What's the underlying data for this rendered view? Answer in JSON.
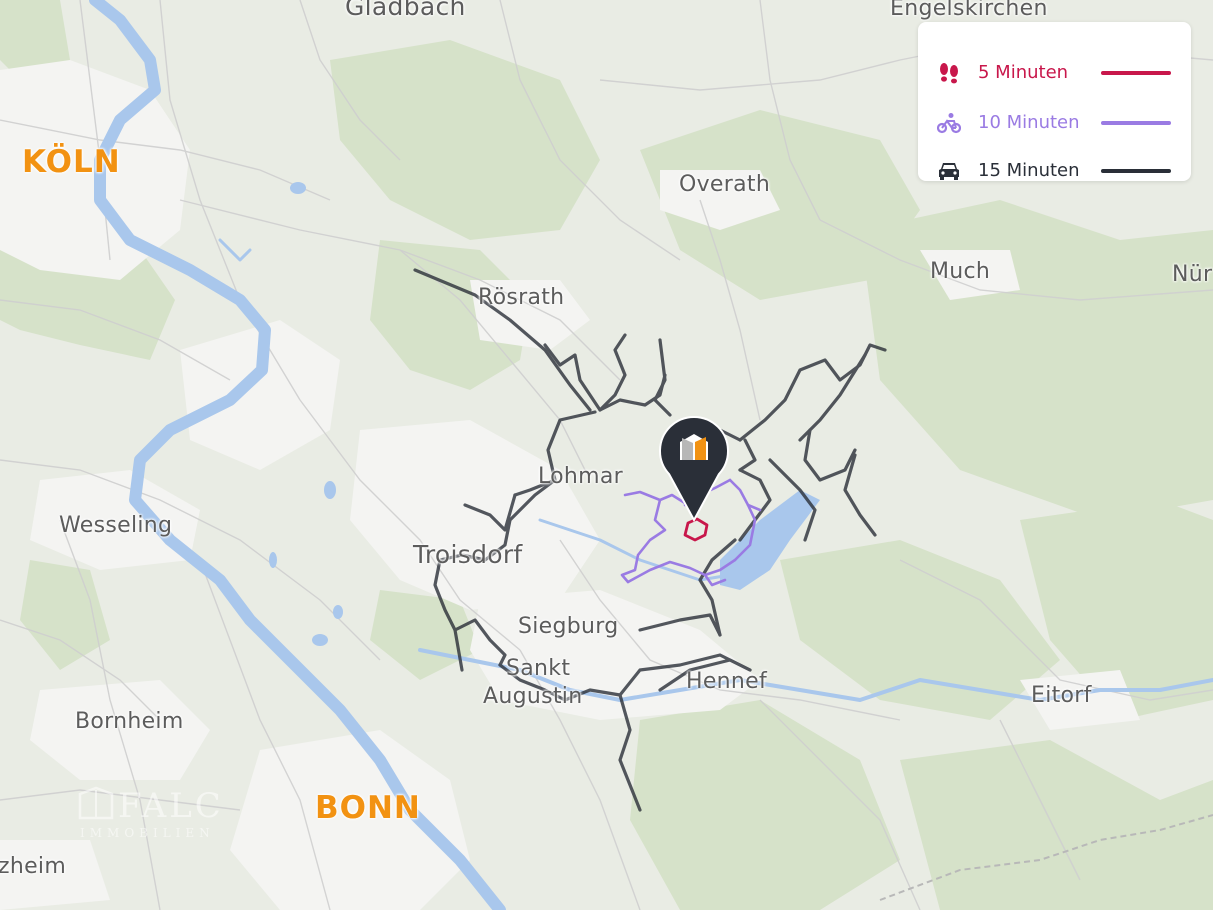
{
  "map": {
    "colors": {
      "land": "#e9ece4",
      "forest": "#d6e2c9",
      "urban": "#f4f4f2",
      "water": "#a9c7ec",
      "road": "#cfcfcf",
      "walk": "#c8174b",
      "bike": "#9a7be3",
      "car": "#2a2f38",
      "city_label": "#f29212",
      "place_label": "#5c5c5c"
    },
    "places": {
      "koeln": "KÖLN",
      "bonn": "BONN",
      "gladbach": "Gladbach",
      "engelskirchen": "Engelskirchen",
      "overath": "Overath",
      "much": "Much",
      "nuern": "Nür",
      "roesrath": "Rösrath",
      "lohmar": "Lohmar",
      "wesseling": "Wesseling",
      "troisdorf": "Troisdorf",
      "siegburg": "Siegburg",
      "sankt": "Sankt",
      "augustin": "Augustin",
      "hennef": "Hennef",
      "eitorf": "Eitorf",
      "bornheim": "Bornheim",
      "zheim": "zheim"
    },
    "watermark": {
      "name": "FALC",
      "sub": "IMMOBILIEN"
    },
    "marker_icon": "location-pin-icon"
  },
  "legend": {
    "items": [
      {
        "icon": "footprints-icon",
        "label": "5 Minuten",
        "color": "#c8174b"
      },
      {
        "icon": "bicycle-icon",
        "label": "10 Minuten",
        "color": "#9a7be3"
      },
      {
        "icon": "car-icon",
        "label": "15 Minuten",
        "color": "#2a2f38"
      }
    ]
  }
}
